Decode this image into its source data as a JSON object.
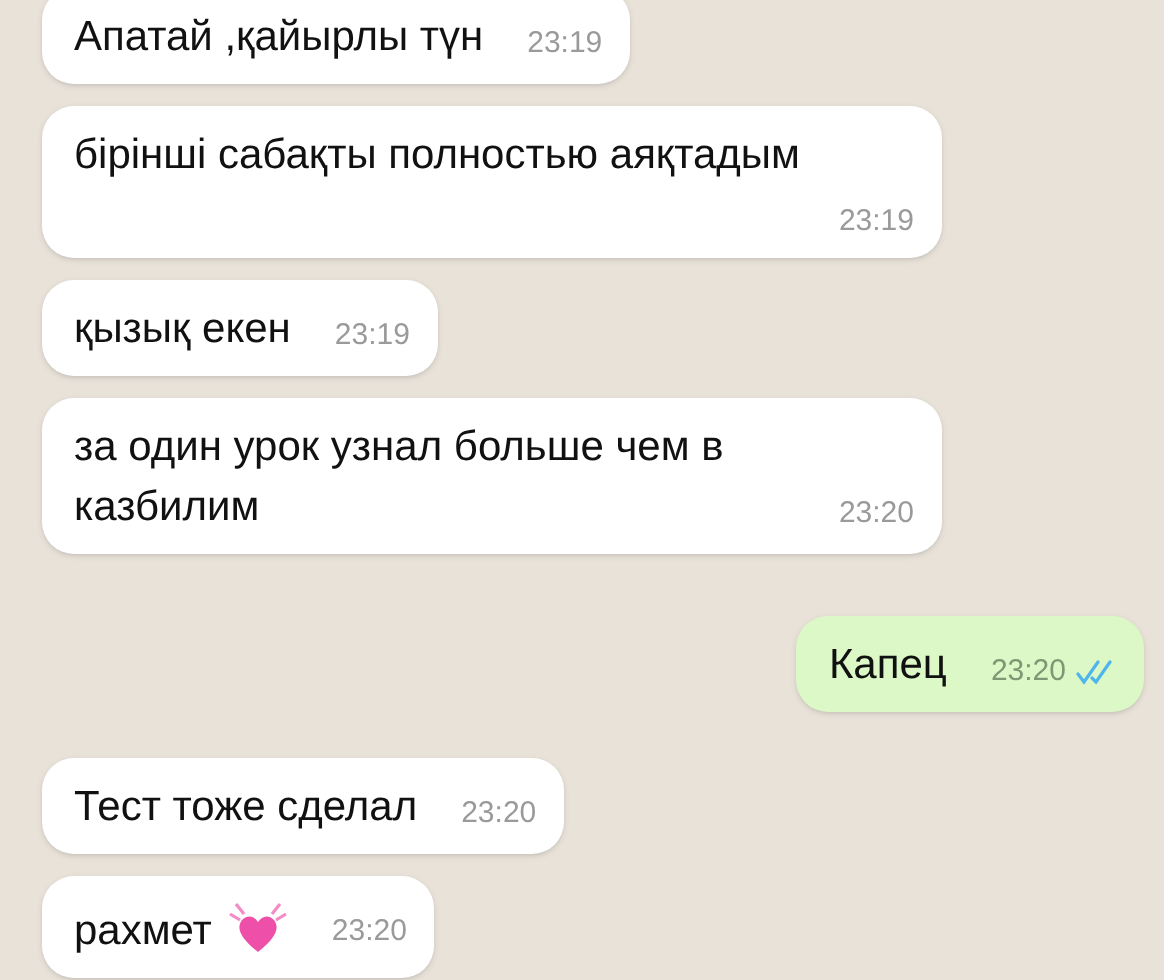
{
  "messages": [
    {
      "kind": "incoming",
      "text": "Апатай ,қайырлы түн",
      "time": "23:19"
    },
    {
      "kind": "incoming",
      "text": "бірінші сабақты полностью аяқтадым",
      "time": "23:19"
    },
    {
      "kind": "incoming",
      "text": "қызық екен",
      "time": "23:19"
    },
    {
      "kind": "incoming",
      "text": "за один урок узнал больше чем в казбилим",
      "time": "23:20"
    },
    {
      "kind": "outgoing",
      "text": "Капец",
      "time": "23:20",
      "read": true
    },
    {
      "kind": "incoming",
      "text": "Тест тоже сделал",
      "time": "23:20"
    },
    {
      "kind": "incoming",
      "text": "рахмет",
      "time": "23:20",
      "heart": true
    }
  ]
}
